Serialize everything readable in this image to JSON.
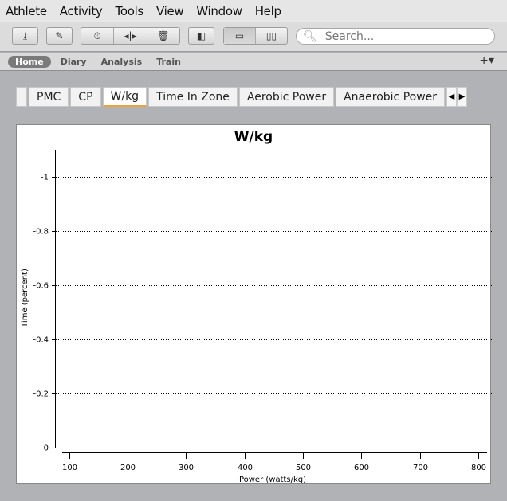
{
  "menu": [
    "Athlete",
    "Activity",
    "Tools",
    "View",
    "Window",
    "Help"
  ],
  "search": {
    "placeholder": "Search..."
  },
  "views": [
    "Home",
    "Diary",
    "Analysis",
    "Train"
  ],
  "add_label": "+▾",
  "tabs": [
    "PMC",
    "CP",
    "W/kg",
    "Time In Zone",
    "Aerobic Power",
    "Anaerobic Power"
  ],
  "chart_data": {
    "type": "line",
    "title": "W/kg",
    "xlabel": "Power (watts/kg)",
    "ylabel": "Time (percent)",
    "xlim": [
      88,
      815
    ],
    "ylim": [
      0,
      -1.1
    ],
    "xticks": [
      100,
      200,
      300,
      400,
      500,
      600,
      700,
      800
    ],
    "yticks": [
      -1,
      -0.8,
      -0.6,
      -0.4,
      -0.2,
      0
    ],
    "ytick_labels": [
      "-1",
      "-0.8",
      "-0.6",
      "-0.4",
      "-0.2",
      "0"
    ],
    "grid": true,
    "series": []
  }
}
